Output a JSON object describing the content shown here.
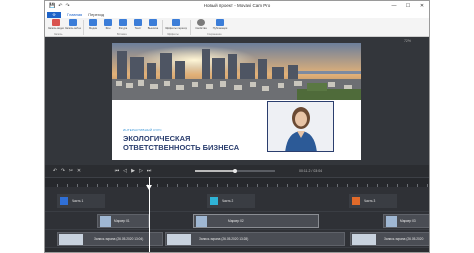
{
  "window": {
    "title": "Новый проект - Movavi Cam Pro",
    "controls": [
      "—",
      "☐",
      "✕"
    ]
  },
  "quick_access": [
    "💾",
    "↶",
    "↷"
  ],
  "ribbon_tabs": [
    "Главная",
    "Переход"
  ],
  "file_button": "Ф",
  "ribbon": {
    "buttons": [
      {
        "label": "Запись видео",
        "color": "#d9534f"
      },
      {
        "label": "Запись веб-камеры",
        "color": "#3b7dd8"
      },
      {
        "label": "Медиа",
        "color": "#3b7dd8"
      },
      {
        "label": "Фон",
        "color": "#3b7dd8"
      },
      {
        "label": "Фигура",
        "color": "#3b7dd8"
      },
      {
        "label": "Текст",
        "color": "#3b7dd8"
      },
      {
        "label": "Выноска",
        "color": "#3b7dd8"
      },
      {
        "label": "Эффекты переходов",
        "color": "#3b7dd8"
      },
      {
        "label": "Свойства",
        "color": "#7a7a7a"
      },
      {
        "label": "Публикация",
        "color": "#3b7dd8"
      }
    ],
    "groups": [
      "Запись",
      "Вставка",
      "Эффекты",
      "Сохранение"
    ]
  },
  "preview": {
    "zoom": "72%",
    "slide": {
      "subtitle": "ИНТЕРАКТИВНЫЙ КУРС",
      "title_line1": "ЭКОЛОГИЧЕСКАЯ",
      "title_line2": "ОТВЕТСТВЕННОСТЬ БИЗНЕСА"
    }
  },
  "transport": {
    "time": "00:11.2 / 03:04",
    "progress": 0.5
  },
  "tracks": {
    "parts": [
      {
        "label": "Часть 1",
        "color": "#2f6fd6"
      },
      {
        "label": "Часть 2",
        "color": "#2fb3d6"
      },
      {
        "label": "Часть 3",
        "color": "#e06a2a"
      }
    ],
    "markers": [
      {
        "label": "Маркер 01"
      },
      {
        "label": "Маркер 02"
      },
      {
        "label": "Маркер 03"
      }
    ],
    "recordings": [
      {
        "label": "Запись экрана (26.05.2020 13:04)"
      },
      {
        "label": "Запись экрана (26.05.2020 13:28)"
      },
      {
        "label": "Запись экрана (26.05.2020"
      }
    ]
  }
}
